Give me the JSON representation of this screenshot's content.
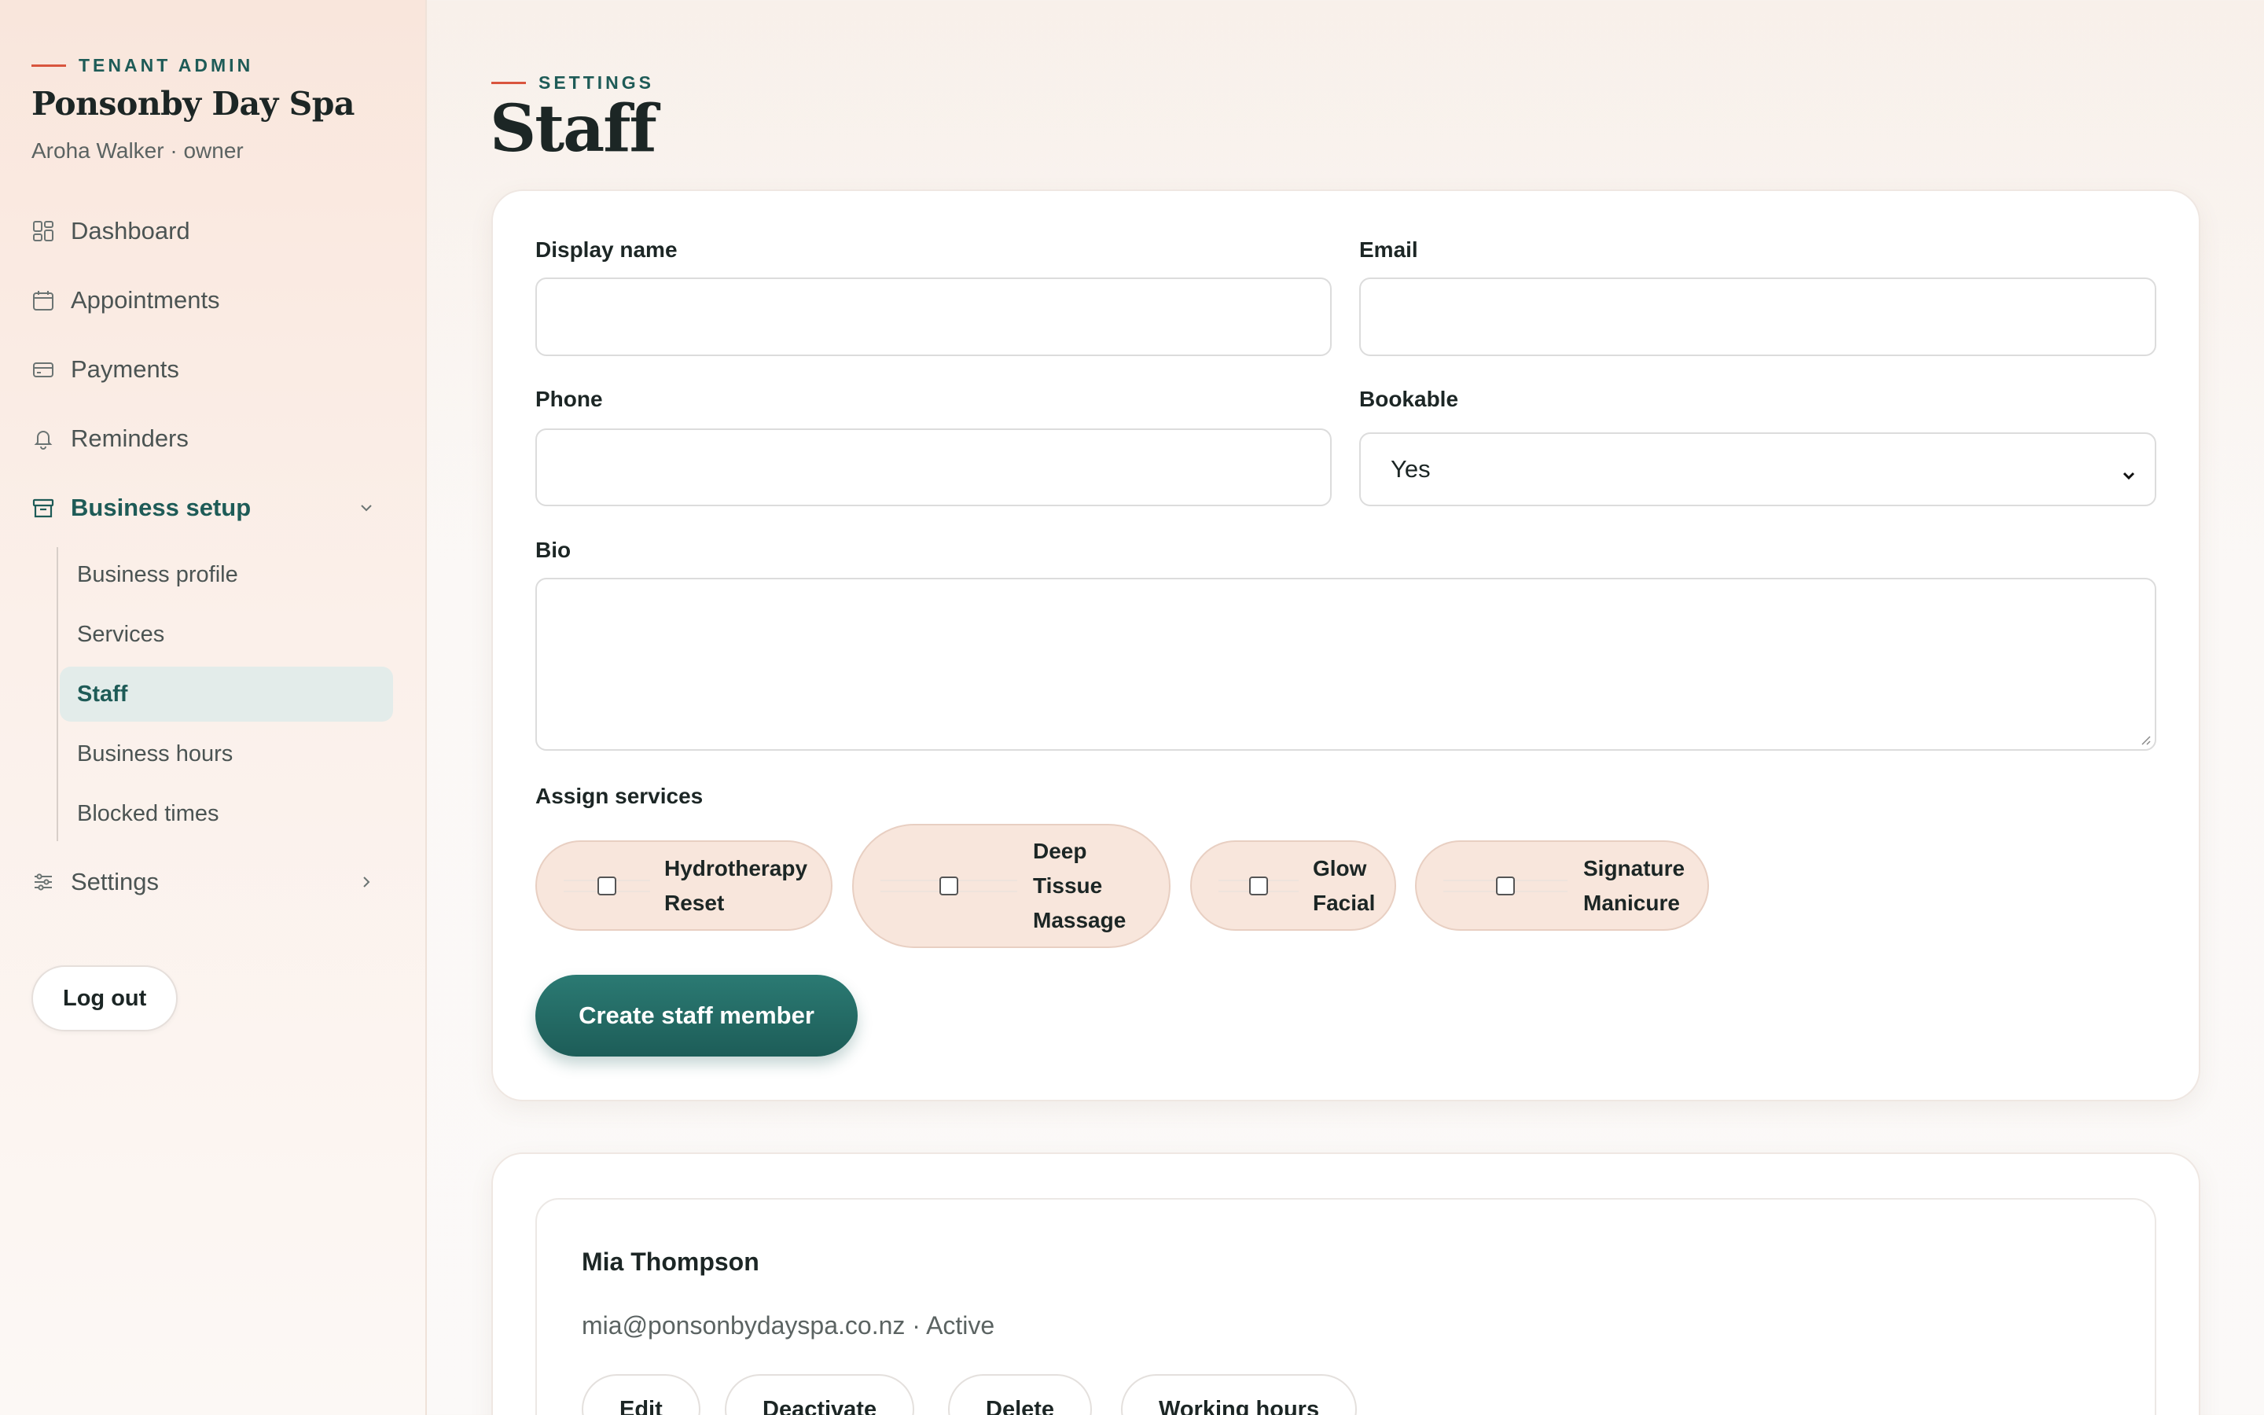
{
  "sidebar": {
    "eyebrow": "TENANT ADMIN",
    "business_name": "Ponsonby Day Spa",
    "user_line": "Aroha Walker · owner",
    "nav": [
      {
        "label": "Dashboard",
        "icon": "dashboard-icon"
      },
      {
        "label": "Appointments",
        "icon": "calendar-icon"
      },
      {
        "label": "Payments",
        "icon": "card-icon"
      },
      {
        "label": "Reminders",
        "icon": "bell-icon"
      },
      {
        "label": "Business setup",
        "icon": "store-icon",
        "expanded": true
      },
      {
        "label": "Settings",
        "icon": "sliders-icon"
      }
    ],
    "business_setup_items": [
      {
        "label": "Business profile"
      },
      {
        "label": "Services"
      },
      {
        "label": "Staff",
        "active": true
      },
      {
        "label": "Business hours"
      },
      {
        "label": "Blocked times"
      }
    ],
    "logout_label": "Log out"
  },
  "header": {
    "eyebrow": "SETTINGS",
    "title": "Staff"
  },
  "form": {
    "display_name_label": "Display name",
    "display_name_value": "",
    "email_label": "Email",
    "email_value": "",
    "phone_label": "Phone",
    "phone_value": "",
    "bookable_label": "Bookable",
    "bookable_value": "Yes",
    "bio_label": "Bio",
    "bio_value": "",
    "assign_services_label": "Assign services",
    "services": [
      {
        "line1": "Hydrotherapy",
        "line2": "Reset",
        "line3": "",
        "checked": false
      },
      {
        "line1": "Deep",
        "line2": "Tissue",
        "line3": "Massage",
        "checked": false
      },
      {
        "line1": "Glow",
        "line2": "Facial",
        "line3": "",
        "checked": false
      },
      {
        "line1": "Signature",
        "line2": "Manicure",
        "line3": "",
        "checked": false
      }
    ],
    "submit_label": "Create staff member"
  },
  "staff_list": [
    {
      "name": "Mia Thompson",
      "meta": "mia@ponsonbydayspa.co.nz · Active",
      "actions": [
        "Edit",
        "Deactivate",
        "Delete",
        "Working hours"
      ]
    }
  ],
  "colors": {
    "accent": "#1e5b57",
    "eyebrow_dash": "#d9553e",
    "chip_bg": "#f8e6dc",
    "active_nav_bg": "#e3ecea"
  }
}
